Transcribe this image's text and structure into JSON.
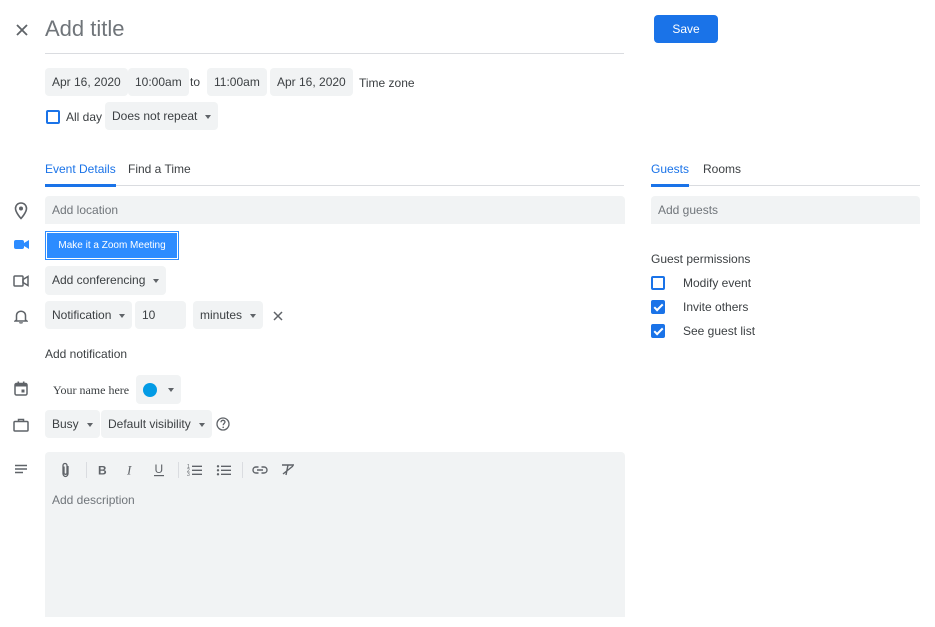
{
  "header": {
    "title_placeholder": "Add title",
    "save_label": "Save"
  },
  "datetime": {
    "start_date": "Apr 16, 2020",
    "start_time": "10:00am",
    "to_label": "to",
    "end_time": "11:00am",
    "end_date": "Apr 16, 2020",
    "time_zone_label": "Time zone"
  },
  "options": {
    "all_day_label": "All day",
    "all_day_checked": false,
    "repeat_value": "Does not repeat"
  },
  "tabs": {
    "left": [
      {
        "label": "Event Details",
        "active": true
      },
      {
        "label": "Find a Time",
        "active": false
      }
    ],
    "right": [
      {
        "label": "Guests",
        "active": true
      },
      {
        "label": "Rooms",
        "active": false
      }
    ]
  },
  "details": {
    "location_placeholder": "Add location",
    "zoom_button_label": "Make it a Zoom Meeting",
    "conferencing_label": "Add conferencing",
    "notification_type": "Notification",
    "notification_amount": "10",
    "notification_unit": "minutes",
    "add_notification_label": "Add notification",
    "calendar_owner": "Your name here",
    "calendar_color": "#039be5",
    "availability": "Busy",
    "visibility": "Default visibility",
    "description_placeholder": "Add description"
  },
  "guests": {
    "add_guests_placeholder": "Add guests",
    "permissions_title": "Guest permissions",
    "permissions": [
      {
        "label": "Modify event",
        "checked": false
      },
      {
        "label": "Invite others",
        "checked": true
      },
      {
        "label": "See guest list",
        "checked": true
      }
    ]
  },
  "colors": {
    "accent": "#1a73e8",
    "zoom_button": "#2d8cff",
    "field_bg": "#f1f3f4"
  }
}
